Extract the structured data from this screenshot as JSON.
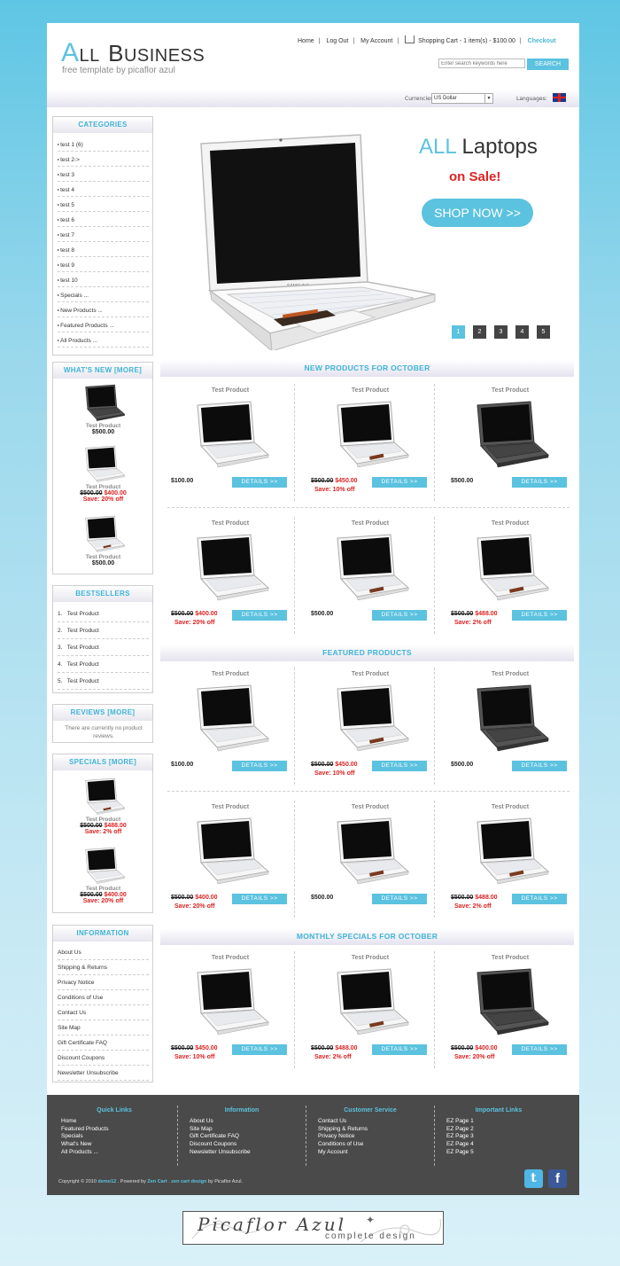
{
  "header": {
    "logo_a": "A",
    "logo_ll": "LL",
    "logo_b": "B",
    "logo_usiness": "USINESS",
    "tagline": "free template by picaflor azul",
    "nav": [
      "Home",
      "Log Out",
      "My Account"
    ],
    "cart": "Shopping Cart - 1 item(s) - $100.00",
    "checkout": "Checkout",
    "search_placeholder": "Enter search keywords here",
    "search_button": "SEARCH",
    "currencies_label": "Currencies:",
    "currency_value": "US Dollar",
    "languages_label": "Languages:"
  },
  "slider": {
    "heading_accent": "ALL",
    "heading_rest": "Laptops",
    "subheading": "on Sale!",
    "cta": "SHOP NOW >>",
    "pages": [
      "1",
      "2",
      "3",
      "4",
      "5"
    ],
    "laptop_brand": "SAMSUNG"
  },
  "categories": {
    "title": "CATEGORIES",
    "items": [
      "test 1 (6)",
      "test 2->",
      "test 3",
      "test 4",
      "test 5",
      "test 6",
      "test 7",
      "test 8",
      "test 9",
      "test 10",
      "Specials ...",
      "New Products ...",
      "Featured Products ...",
      "All Products ..."
    ]
  },
  "whats_new": {
    "title": "WHAT'S NEW  [MORE]",
    "items": [
      {
        "name": "Test Product",
        "price": "$500.00"
      },
      {
        "name": "Test Product",
        "old": "$500.00",
        "new": "$400.00",
        "save": "Save: 20% off"
      },
      {
        "name": "Test Product",
        "price": "$500.00"
      }
    ]
  },
  "bestsellers": {
    "title": "BESTSELLERS",
    "items": [
      "1.   Test Product",
      "2.   Test Product",
      "3.   Test Product",
      "4.   Test Product",
      "5.   Test Product"
    ]
  },
  "reviews": {
    "title": "REVIEWS  [MORE]",
    "text": "There are currently no product reviews."
  },
  "specials_side": {
    "title": "SPECIALS  [MORE]",
    "items": [
      {
        "name": "Test Product",
        "old": "$500.00",
        "new": "$488.00",
        "save": "Save: 2% off"
      },
      {
        "name": "Test Product",
        "old": "$500.00",
        "new": "$400.00",
        "save": "Save: 20% off"
      }
    ]
  },
  "information": {
    "title": "INFORMATION",
    "items": [
      "About Us",
      "Shipping & Returns",
      "Privacy Notice",
      "Conditions of Use",
      "Contact Us",
      "Site Map",
      "Gift Certificate FAQ",
      "Discount Coupons",
      "Newsletter Unsubscribe"
    ]
  },
  "sections": {
    "new_title": "NEW PRODUCTS FOR OCTOBER",
    "featured_title": "FEATURED PRODUCTS",
    "monthly_title": "MONTHLY SPECIALS FOR OCTOBER",
    "product_name": "Test Product",
    "details": "DETAILS >>",
    "new_products": [
      {
        "price": "$100.00"
      },
      {
        "old": "$500.00",
        "new": "$450.00",
        "save": "Save: 10% off"
      },
      {
        "price": "$500.00"
      },
      {
        "old": "$500.00",
        "new": "$400.00",
        "save": "Save: 20% off"
      },
      {
        "price": "$500.00"
      },
      {
        "old": "$500.00",
        "new": "$488.00",
        "save": "Save: 2% off"
      }
    ],
    "featured_products": [
      {
        "price": "$100.00"
      },
      {
        "old": "$500.00",
        "new": "$450.00",
        "save": "Save: 10% off"
      },
      {
        "price": "$500.00"
      },
      {
        "old": "$500.00",
        "new": "$400.00",
        "save": "Save: 20% off"
      },
      {
        "price": "$500.00"
      },
      {
        "old": "$500.00",
        "new": "$488.00",
        "save": "Save: 2% off"
      }
    ],
    "monthly_products": [
      {
        "old": "$500.00",
        "new": "$450.00",
        "save": "Save: 10% off"
      },
      {
        "old": "$500.00",
        "new": "$488.00",
        "save": "Save: 2% off"
      },
      {
        "old": "$500.00",
        "new": "$400.00",
        "save": "Save: 20% off"
      }
    ]
  },
  "footer": {
    "quick_links": {
      "title": "Quick Links",
      "items": [
        "Home",
        "Featured Products",
        "Specials",
        "What's New",
        "All Products ..."
      ]
    },
    "information": {
      "title": "Information",
      "items": [
        "About Us",
        "Site Map",
        "Gift Certificate FAQ",
        "Discount Coupons",
        "Newsletter Unsubscribe"
      ]
    },
    "customer_service": {
      "title": "Customer Service",
      "items": [
        "Contact Us",
        "Shipping & Returns",
        "Privacy Notice",
        "Conditions of Use",
        "My Account"
      ]
    },
    "important_links": {
      "title": "Important Links",
      "items": [
        "EZ Page 1",
        "EZ Page 2",
        "EZ Page 3",
        "EZ Page 4",
        "EZ Page 5"
      ]
    },
    "copyright": "Copyright © 2010",
    "demo": "demo12",
    "powered": ". Powered by",
    "zen_cart": "Zen Cart",
    "zcd": "zen cart design",
    "by": "by Picaflor Azul."
  },
  "bottom_banner": {
    "script": "Picaflor Azul",
    "sub": "complete design"
  },
  "colors": {
    "accent": "#5bc2df",
    "sale": "#dd2222",
    "footer": "#4a4a4a"
  }
}
